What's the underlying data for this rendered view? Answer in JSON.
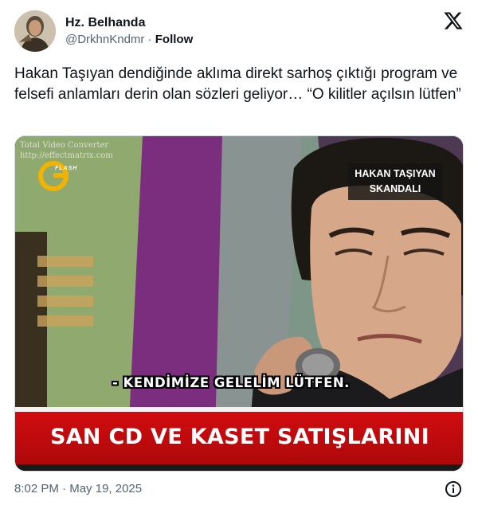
{
  "author": {
    "display_name": "Hz. Belhanda",
    "handle": "@DrkhnKndmr",
    "separator": "·",
    "follow_label": "Follow"
  },
  "icons": {
    "platform": "x-logo-icon",
    "info": "info-icon"
  },
  "tweet": {
    "text": "Hakan Taşıyan dendiğinde aklıma direkt sarhoş çıktığı program ve felsefi anlamları derin olan sözleri geliyor… “O kilitler açılsın lütfen”"
  },
  "media": {
    "watermark_line1": "Total Video Converter",
    "watermark_line2": "http://effectmatrix.com",
    "channel_logo_text": "FLASH",
    "tag_line1": "HAKAN TAŞIYAN",
    "tag_line2": "SKANDALI",
    "subtitle": "- KENDİMİZE GELELİM LÜTFEN.",
    "ticker": "SAN CD VE KASET SATIŞLARINI"
  },
  "footer": {
    "time": "8:02 PM",
    "separator": "·",
    "date": "May 19, 2025"
  },
  "colors": {
    "text_primary": "#0f1419",
    "text_secondary": "#536471",
    "ticker_red": "#d40d10"
  }
}
